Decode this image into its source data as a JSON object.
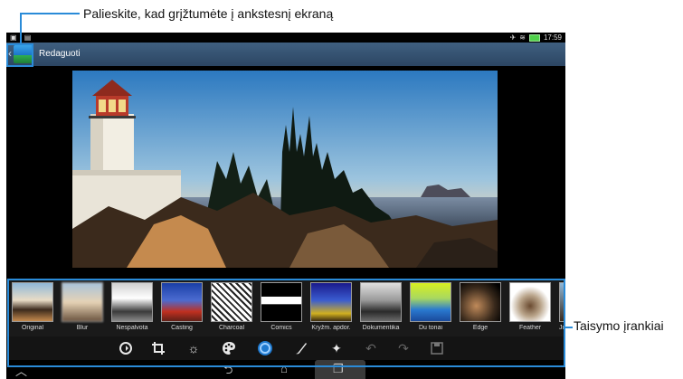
{
  "annotations": {
    "top": "Palieskite, kad grįžtumėte į ankstesnį ekraną",
    "right": "Taisymo įrankiai"
  },
  "status_bar": {
    "time": "17:59",
    "left_icons": [
      "image-icon",
      "gallery-icon"
    ],
    "right_icons": [
      "signal-icon",
      "wifi-icon",
      "battery-icon"
    ]
  },
  "app_bar": {
    "title": "Redaguoti"
  },
  "effects": [
    {
      "label": "Original"
    },
    {
      "label": "Blur"
    },
    {
      "label": "Nespalvota"
    },
    {
      "label": "Casting"
    },
    {
      "label": "Charcoal"
    },
    {
      "label": "Comics"
    },
    {
      "label": "Kryžm. apdor."
    },
    {
      "label": "Dokumentika"
    },
    {
      "label": "Du tonai"
    },
    {
      "label": "Edge"
    },
    {
      "label": "Feather"
    },
    {
      "label": "Ju"
    }
  ],
  "tools": [
    "rotate-icon",
    "crop-icon",
    "brightness-icon",
    "palette-icon",
    "effects-icon",
    "brush-icon",
    "sparkle-icon",
    "undo-icon",
    "redo-icon",
    "save-icon"
  ],
  "nav_bar": [
    "back-icon",
    "home-icon",
    "recents-icon"
  ],
  "colors": {
    "accent": "#2a8bd8",
    "app_bar": "#3f5f80"
  }
}
